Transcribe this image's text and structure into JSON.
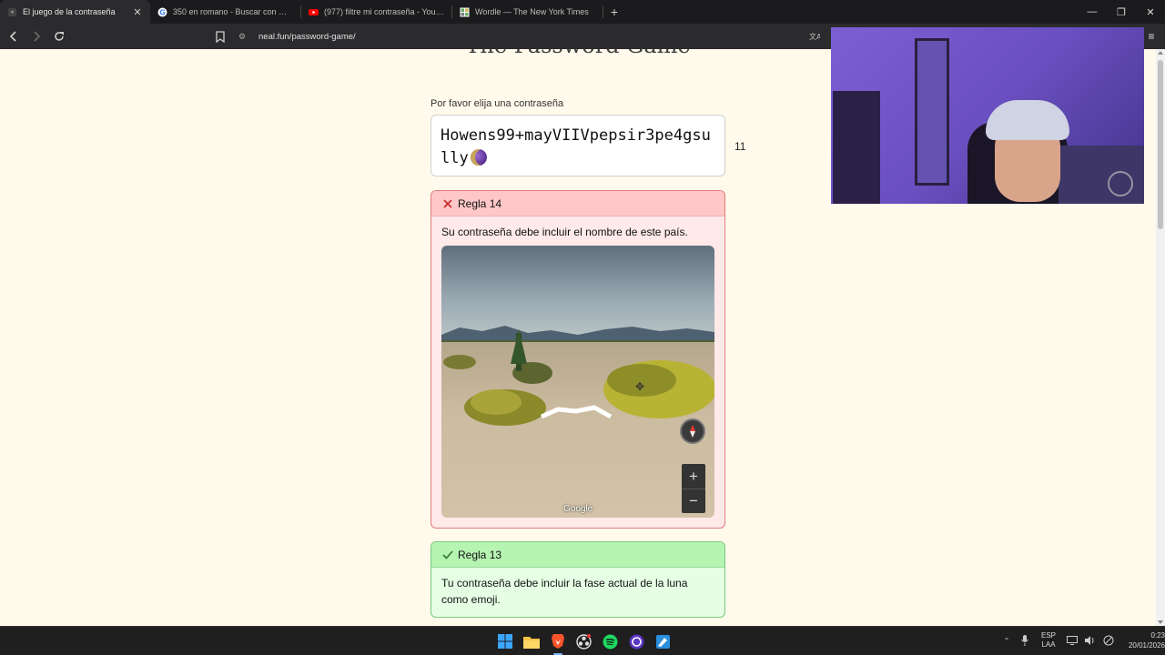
{
  "tabs": [
    {
      "title": "El juego de la contraseña",
      "active": true
    },
    {
      "title": "350 en romano - Buscar con Google",
      "active": false
    },
    {
      "title": "(977) filtre mi contraseña - YouTube",
      "active": false
    },
    {
      "title": "Wordle — The New York Times",
      "active": false
    }
  ],
  "address_bar": {
    "url": "neal.fun/password-game/"
  },
  "page": {
    "title": "The Password Game",
    "prompt": "Por favor elija una contraseña",
    "password": "Howens99+mayVIIVpepsir3pe4gsully",
    "password_length_counter": "11",
    "rules": [
      {
        "header": "Regla 14",
        "status": "fail",
        "text": "Su contraseña debe incluir el nombre de este país.",
        "map_attribution": "Google"
      },
      {
        "header": "Regla 13",
        "status": "pass",
        "text": "Tu contraseña debe incluir la fase actual de la luna como emoji."
      }
    ]
  },
  "taskbar": {
    "language": "ESP",
    "keyboard": "LAA",
    "time": "0:23",
    "date": "20/01/2026"
  }
}
